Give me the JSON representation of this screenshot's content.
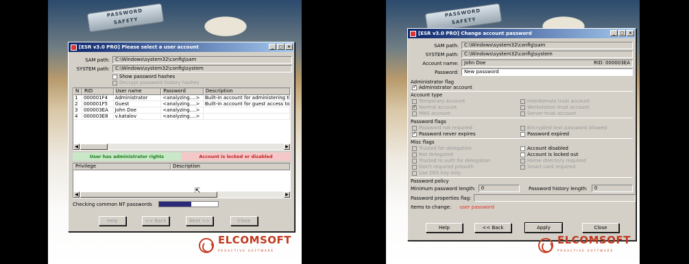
{
  "left": {
    "splash": {
      "line1": "PASSWORD",
      "line2": "SAFETY"
    },
    "logo": {
      "brand": "ELCOMSOFT",
      "tag": "PROACTIVE SOFTWARE"
    },
    "window": {
      "title": "[ESR v3.0 PRO]  Please select a user account",
      "sam_label": "SAM path:",
      "sam_value": "C:\\Windows\\system32\\config\\sam",
      "system_label": "SYSTEM path:",
      "system_value": "C:\\Windows\\system32\\config\\system",
      "show_hashes": "Show password hashes",
      "decrypt_history": "Decrypt password history hashes",
      "columns": [
        "N",
        "RID",
        "User name",
        "Password",
        "Description"
      ],
      "users": [
        {
          "n": "1",
          "rid": "000001F4",
          "name": "Administrator",
          "password": "<analyzing....>",
          "desc": "Built-in account for administering the"
        },
        {
          "n": "2",
          "rid": "000001F5",
          "name": "Guest",
          "password": "<analyzing....>",
          "desc": "Built-in account for guest access to t"
        },
        {
          "n": "3",
          "rid": "000003EA",
          "name": "John Doe",
          "password": "<analyzing....>",
          "desc": ""
        },
        {
          "n": "4",
          "rid": "000003E8",
          "name": "v.katalov",
          "password": "<analyzing....>",
          "desc": ""
        }
      ],
      "legend_admin": "User has administrator rights",
      "legend_locked": "Account is locked or disabled",
      "priv_columns": [
        "Privilege",
        "Description"
      ],
      "status": "Checking common NT passwords",
      "progress": 0.55,
      "buttons": {
        "help": "Help",
        "back": "<< Back",
        "next": "Next >>",
        "close": "Close"
      }
    }
  },
  "right": {
    "splash": {
      "line1": "PASSWORD",
      "line2": "SAFETY"
    },
    "logo": {
      "brand": "ELCOMSOFT",
      "tag": "PROACTIVE SOFTWARE"
    },
    "window": {
      "title": "[ESR v3.0 PRO]  Change account password",
      "sam_label": "SAM path:",
      "sam_value": "C:\\Windows\\system32\\config\\sam",
      "system_label": "SYSTEM path:",
      "system_value": "C:\\Windows\\system32\\config\\system",
      "account_label": "Account name:",
      "account_value": "John Doe",
      "rid_value": "RID: 000003EA",
      "password_label": "Password:",
      "password_value": "New password",
      "admin_flag_group": "Administrator flag",
      "admin_account": "Administrator account",
      "account_type_group": "Account type",
      "types": [
        "Temporary account",
        "Normal account",
        "MNS account",
        "Interdomain trust account",
        "Workstation trust account",
        "Server trust account"
      ],
      "password_flags_group": "Password flags",
      "pw_not_required": "Password not required",
      "pw_never_expires": "Password never expires",
      "encrypted_text": "Encrypted text password allowed",
      "pw_expired": "Password expired",
      "misc_group": "Misc flags",
      "misc_left": [
        "Trusted for delegation",
        "Not delegated",
        "Trusted to auth for delegation",
        "Don't required preauth",
        "Use DES key only"
      ],
      "misc_right": [
        "Account disabled",
        "Account is locked out",
        "Home directory required",
        "Smart card required"
      ],
      "policy_group": "Password policy",
      "min_len_label": "Minimum password length:",
      "min_len_value": "0",
      "history_label": "Password history length:",
      "history_value": "0",
      "properties_label": "Password properties flag:",
      "items_label": "Items to change:",
      "items_value": "user password",
      "buttons": {
        "help": "Help",
        "back": "<< Back",
        "apply": "Apply",
        "close": "Close"
      }
    }
  }
}
